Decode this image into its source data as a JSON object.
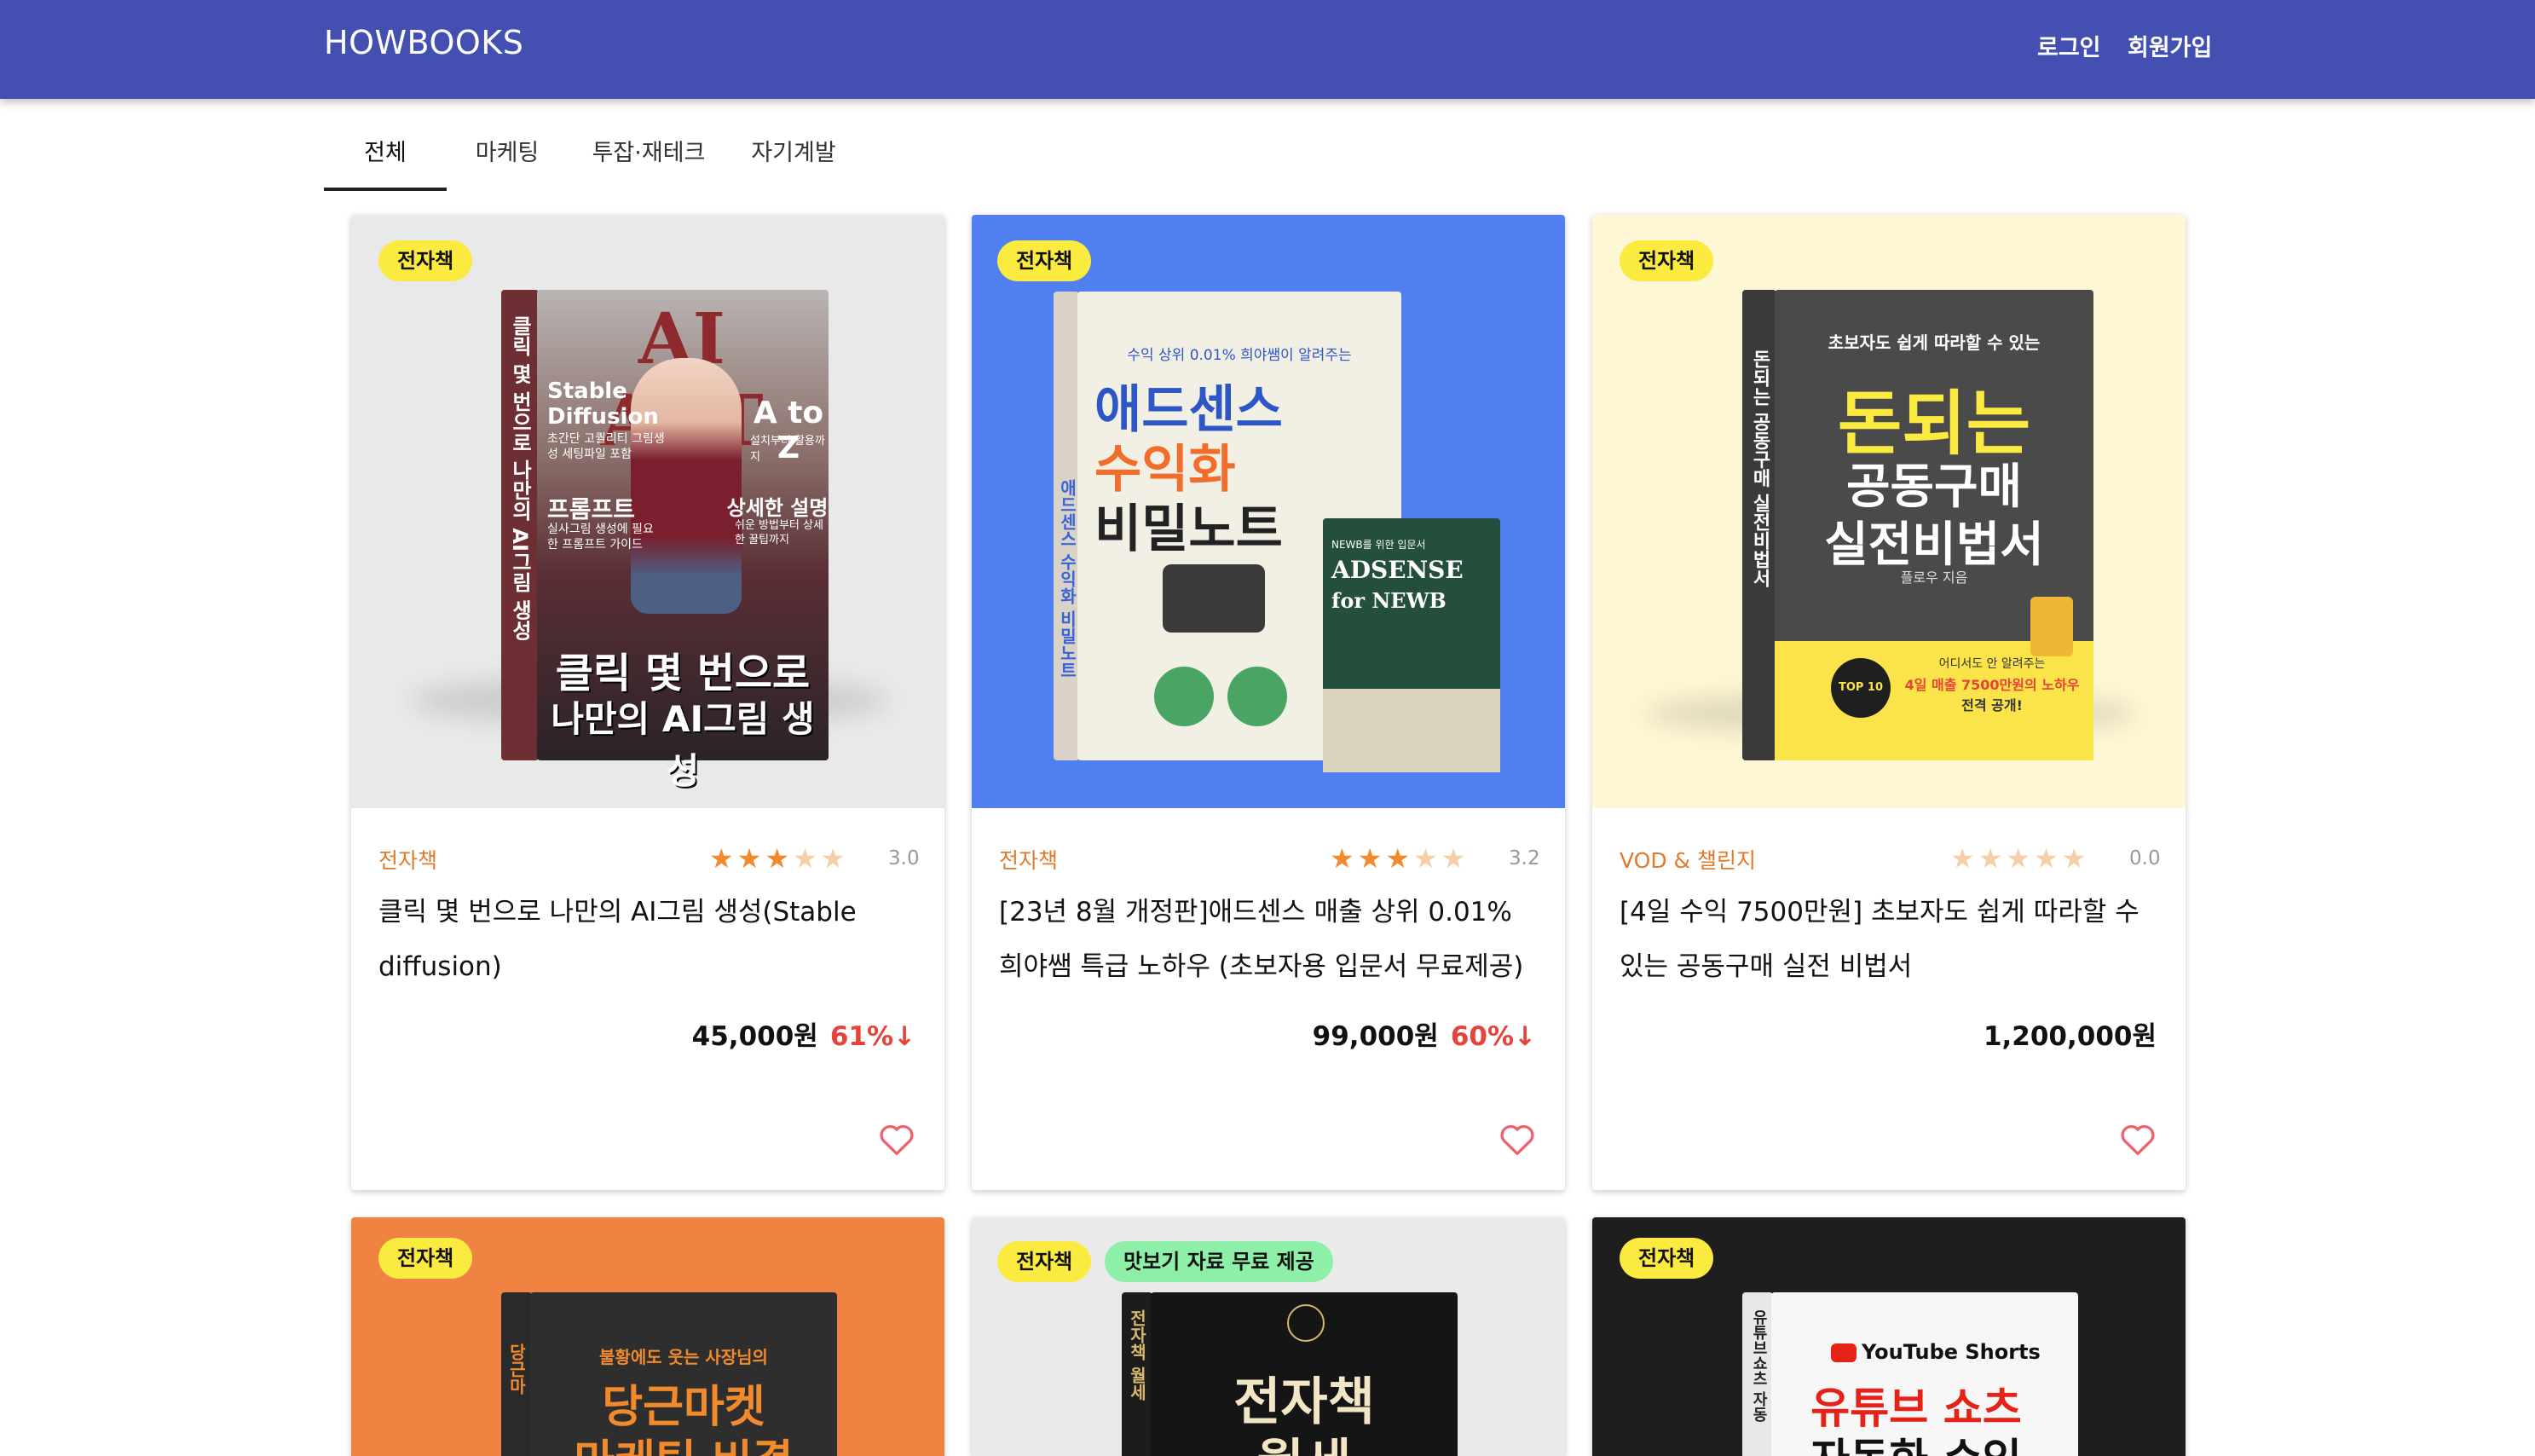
{
  "header": {
    "brand": "HOWBOOKS",
    "login": "로그인",
    "signup": "회원가입"
  },
  "tabs": [
    {
      "label": "전체",
      "active": true
    },
    {
      "label": "마케팅"
    },
    {
      "label": "투잡·재테크"
    },
    {
      "label": "자기계발"
    }
  ],
  "cards": [
    {
      "badge": "전자책",
      "category": "전자책",
      "rating": "3.0",
      "stars": 3,
      "title": "클릭 몇 번으로 나만의 AI그림 생성(Stable diffusion)",
      "price": "45,000원",
      "discount": "61%↓",
      "bg": "#e9e9e9",
      "cover": {
        "top": "AI ART",
        "side": "클릭 몇 번으로 나만의 AI그림 생성",
        "left_title": "Stable Diffusion",
        "left_sub": "초간단 고퀄리티 그림생성 세팅파일 포함",
        "right_title": "A to Z",
        "right_sub": "설치부터 활용까지",
        "mid_left": "프롬프트",
        "mid_left_sub": "실사그림 생성에 필요한 프롬프트 가이드",
        "mid_right": "상세한 설명",
        "mid_right_sub": "쉬운 방법부터 상세한 꿀팁까지",
        "bottom1": "클릭 몇 번으로",
        "bottom2": "나만의 AI그림 생성"
      }
    },
    {
      "badge": "전자책",
      "category": "전자책",
      "rating": "3.2",
      "stars": 3,
      "title": "[23년 8월 개정판]애드센스 매출 상위 0.01% 희야쌤 특급 노하우 (초보자용 입문서 무료제공)",
      "price": "99,000원",
      "discount": "60%↓",
      "bg": "#4f7ff0",
      "cover": {
        "small": "수익 상위 0.01% 희야쌤이 알려주는",
        "big1": "애드센스",
        "big2": "수익화",
        "big3": "비밀노트",
        "side": "애드센스 수익화 비밀노트",
        "mini_top": "NEWB를 위한 입문서",
        "mini_t1": "ADSENSE",
        "mini_t2": "for NEWB"
      }
    },
    {
      "badge": "전자책",
      "category": "VOD & 챌린지",
      "rating": "0.0",
      "stars": 0,
      "title": "[4일 수익 7500만원] 초보자도 쉽게 따라할 수 있는 공동구매 실전 비법서",
      "price": "1,200,000원",
      "discount": "",
      "bg": "#fdf7d5",
      "cover": {
        "small": "초보자도 쉽게 따라할 수 있는",
        "big1": "돈되는",
        "big2": "공동구매",
        "big3": "실전비법서",
        "author": "플로우 지음",
        "side": "돈되는 공동구매 실전비법서",
        "seal": "TOP 10",
        "foot1": "어디서도 안 알려주는",
        "foot2": "4일 매출 7500만원의 노하우",
        "foot3": "전격 공개!"
      }
    },
    {
      "badge": "전자책",
      "bg": "#ef8442",
      "cover": {
        "small": "불황에도 웃는 사장님의",
        "big1": "당근마켓",
        "big2": "마케팅 비결",
        "side": "당근마"
      }
    },
    {
      "badge": "전자책",
      "badge2": "맛보기 자료 무료 제공",
      "bg": "#eaeaea",
      "cover": {
        "big1": "전자책",
        "big2": "월세",
        "side": "전자책 월세"
      }
    },
    {
      "badge": "전자책",
      "bg": "#1e1e1e",
      "cover": {
        "logo": "YouTube Shorts",
        "big1": "유튜브 쇼츠",
        "big2": "자동화 수익",
        "side": "유튜브쇼츠 자동"
      }
    }
  ]
}
